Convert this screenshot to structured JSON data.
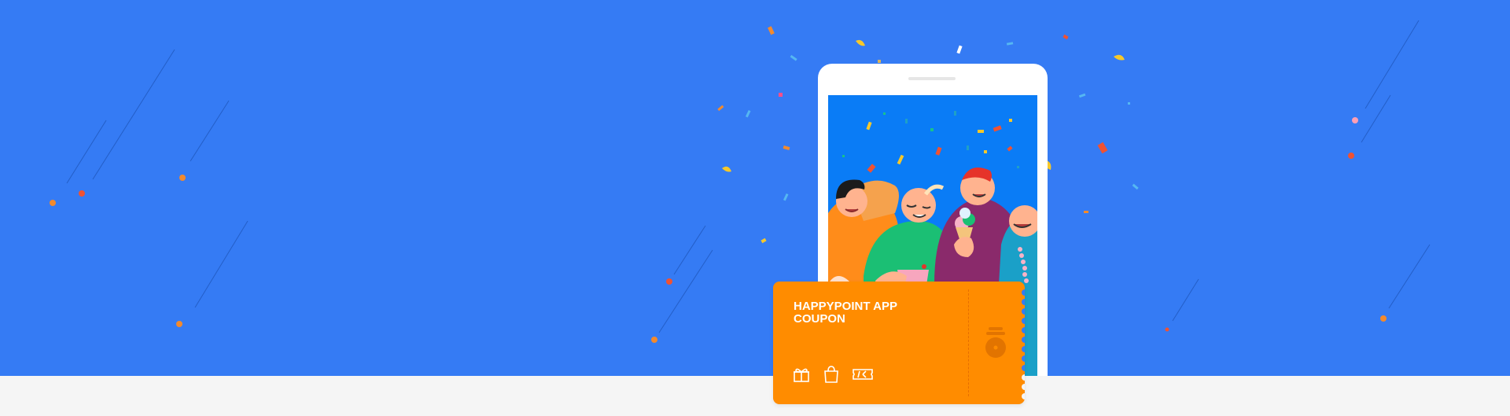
{
  "banner": {
    "background_color": "#357bf4",
    "footer_color": "#f5f5f5",
    "accent_orange": "#ff8c00"
  },
  "coupon": {
    "title": "HAPPYPOINT APP\nCOUPON",
    "icons": [
      "gift-icon",
      "shopping-bag-icon",
      "ticket-icon"
    ],
    "stub_icon": "coin-stack-icon"
  },
  "phone": {
    "illustration": "people-celebrating-with-confetti"
  }
}
